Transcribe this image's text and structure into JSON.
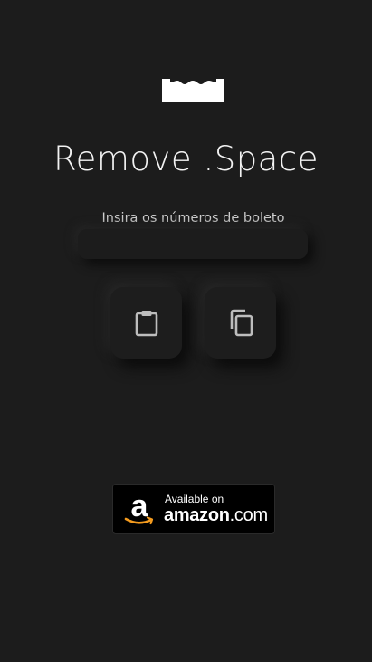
{
  "app": {
    "logo_icon": "crown-logo-icon",
    "title": "Remove .Space"
  },
  "form": {
    "instruction": "Insira os números de boleto",
    "input_value": "",
    "placeholder": ""
  },
  "actions": {
    "paste_icon": "clipboard-icon",
    "copy_icon": "copy-icon"
  },
  "store_badge": {
    "line1": "Available on",
    "brand": "amazon",
    "suffix": ".com",
    "icon": "amazon-logo-icon"
  },
  "colors": {
    "background": "#1c1c1c",
    "text": "#f2f2f2",
    "muted_text": "#cfcfcf",
    "icon": "#bdbdbd",
    "amazon_orange": "#f49b1e"
  }
}
